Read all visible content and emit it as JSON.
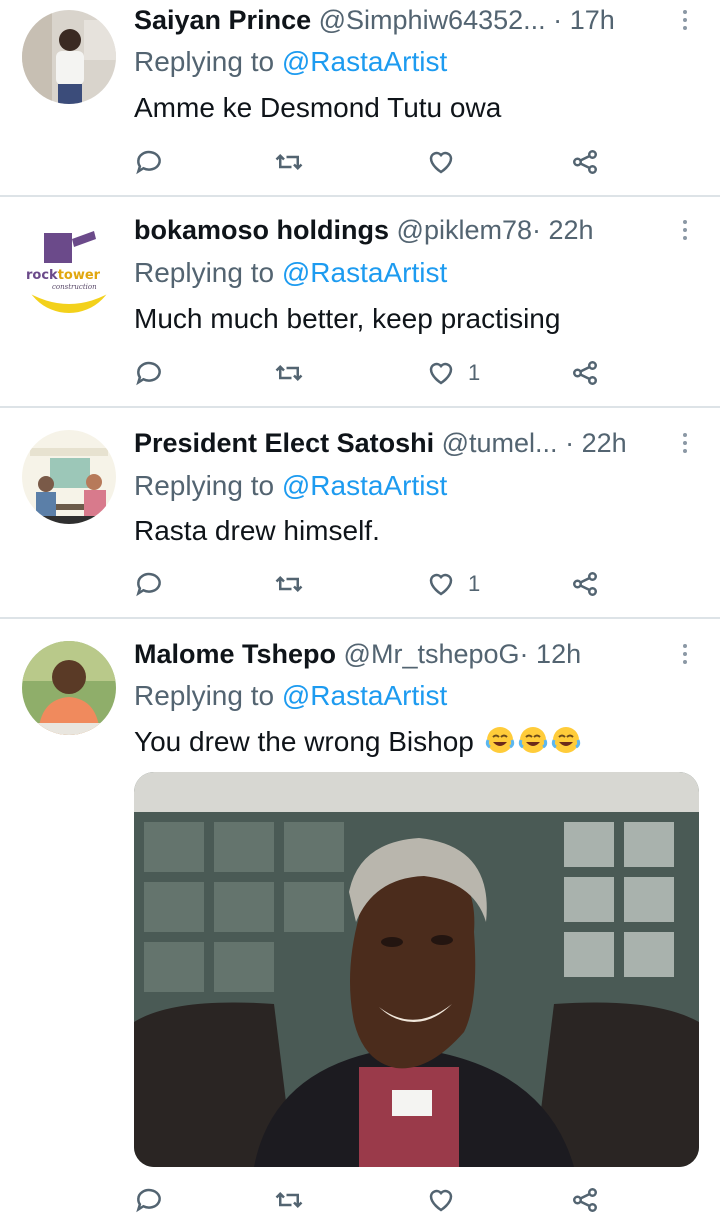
{
  "replying_prefix": "Replying to",
  "tweets": [
    {
      "name": "Saiyan Prince",
      "handle": "@Simphiw64352...",
      "dot": "·",
      "time": "17h",
      "mention": "@RastaArtist",
      "text": "Amme ke Desmond Tutu owa",
      "likes": ""
    },
    {
      "name": "bokamoso holdings",
      "handle": "@piklem78",
      "dot": "·",
      "time": "22h",
      "mention": "@RastaArtist",
      "text": "Much much better, keep practising",
      "likes": "1",
      "avatar_text_1": "rock",
      "avatar_text_2": "tower",
      "avatar_text_3": "construction"
    },
    {
      "name": "President Elect Satoshi",
      "handle": "@tumel...",
      "dot": "·",
      "time": "22h",
      "mention": "@RastaArtist",
      "text": "Rasta drew himself.",
      "likes": "1"
    },
    {
      "name": "Malome Tshepo",
      "handle": "@Mr_tshepoG",
      "dot": "·",
      "time": "12h",
      "mention": "@RastaArtist",
      "text": "You drew the wrong Bishop",
      "likes": "",
      "emoji": [
        "face-with-tears-of-joy",
        "face-with-tears-of-joy",
        "face-with-tears-of-joy"
      ]
    }
  ],
  "colors": {
    "link": "#1d9bf0",
    "secondary_text": "#536471",
    "divider": "#dde3e7"
  }
}
